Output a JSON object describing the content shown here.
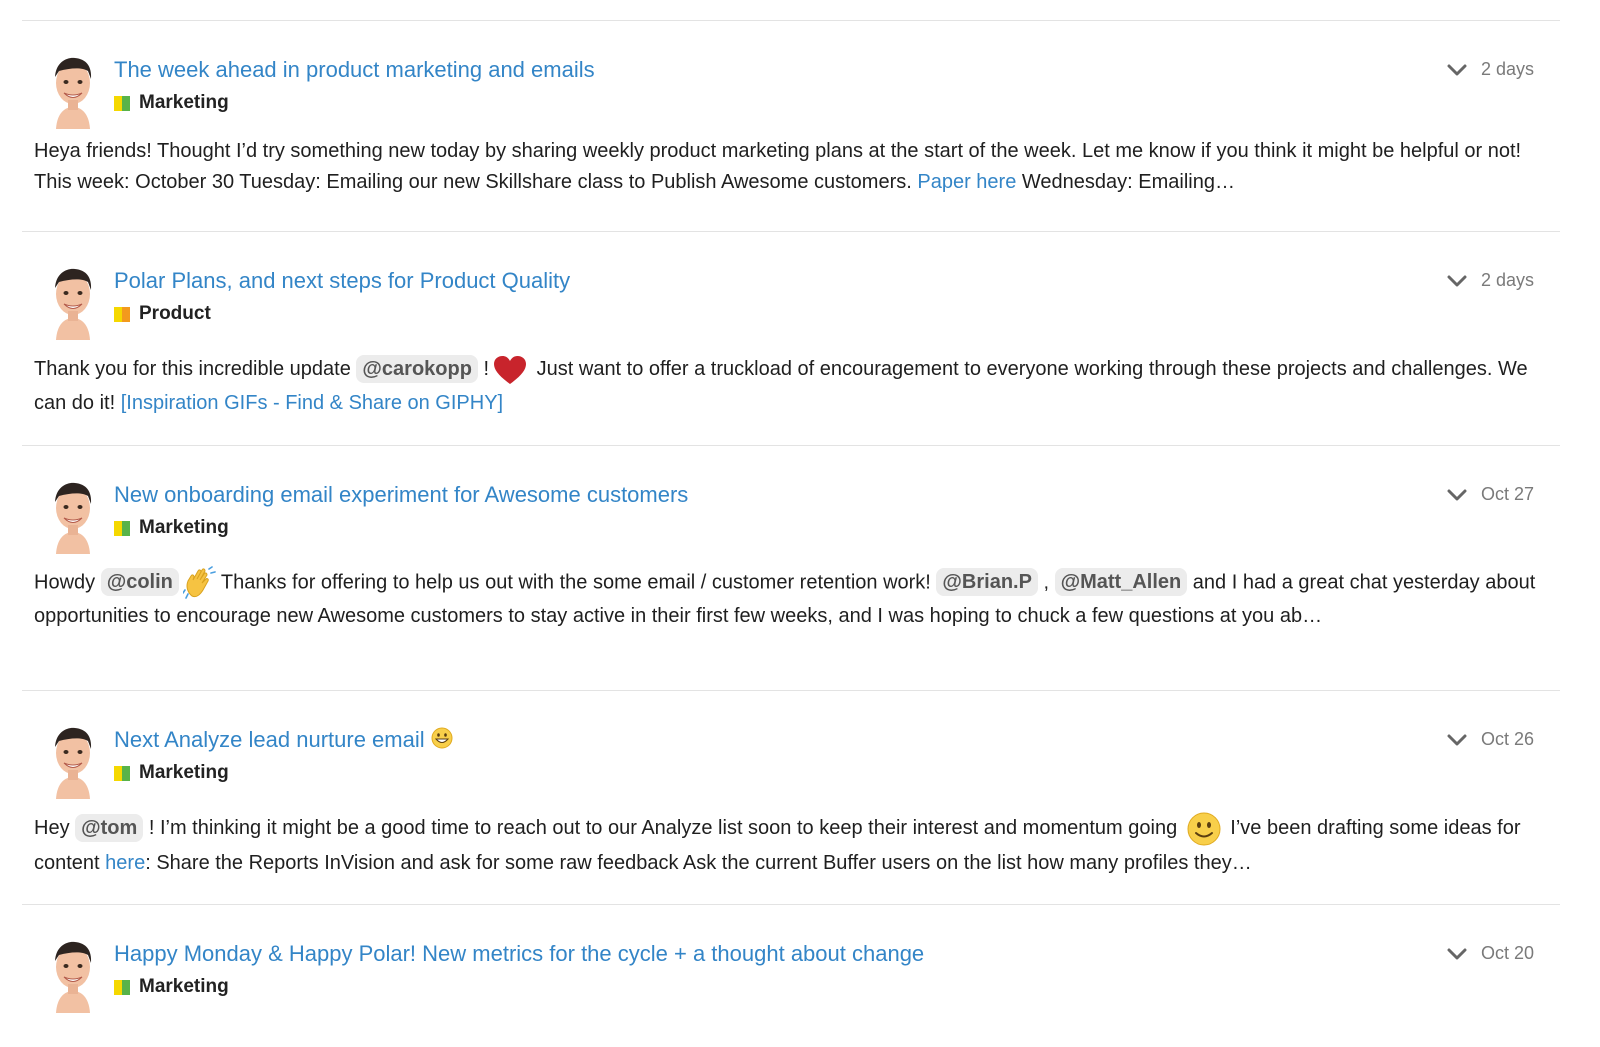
{
  "colors": {
    "link": "#3385c7",
    "category_marketing": [
      "#f5d800",
      "#58b349"
    ],
    "category_product": [
      "#f5d800",
      "#f39a1d"
    ],
    "meta_text": "#7a7a7a",
    "mention_bg": "#ececec"
  },
  "posts": [
    {
      "title": "The week ahead in product marketing and emails",
      "category": "Marketing",
      "age": "2 days",
      "body": {
        "t1": "Heya friends! Thought I’d try something new today by sharing weekly product marketing plans at the start of the week. Let me know if you think it might be helpful or not! This week: October 30 Tuesday: Emailing our new Skillshare class to Publish Awesome customers. ",
        "link1": "Paper here",
        "t2": " Wednesday: Emailing…"
      }
    },
    {
      "title": "Polar Plans, and next steps for Product Quality",
      "category": "Product",
      "age": "2 days",
      "body": {
        "t1": "Thank you for this incredible update ",
        "mention1": "@carokopp",
        "t2": " !",
        "emoji1": "red-heart",
        "t3": " Just want to offer a truckload of encouragement to everyone working through these projects and challenges. We can do it! ",
        "link1": "[Inspiration GIFs - Find & Share on GIPHY]"
      }
    },
    {
      "title": "New onboarding email experiment for Awesome customers",
      "category": "Marketing",
      "age": "Oct 27",
      "body": {
        "t1": "Howdy ",
        "mention1": "@colin",
        "emoji1": "waving-hand",
        "t2": "Thanks for offering to help us out with the some email / customer retention work! ",
        "mention2": "@Brian.P",
        "t3": " , ",
        "mention3": "@Matt_Allen",
        "t4": " and I had a great chat yesterday about opportunities to encourage new Awesome customers to stay active in their first few weeks, and I was hoping to chuck a few questions at you ab…"
      }
    },
    {
      "title": "Next Analyze lead nurture email",
      "title_emoji": "grinning-face",
      "category": "Marketing",
      "age": "Oct 26",
      "body": {
        "t1": "Hey ",
        "mention1": "@tom",
        "t2": " ! I’m thinking it might be a good time to reach out to our Analyze list soon to keep their interest and momentum going ",
        "emoji1": "slightly-smiling-face",
        "t3": " I’ve been drafting some ideas for content ",
        "link1": "here",
        "t4": ": Share the Reports InVision and ask for some raw feedback Ask the current Buffer users on the list how many profiles they…"
      }
    },
    {
      "title": "Happy Monday & Happy Polar! New metrics for the cycle + a thought about change",
      "category": "Marketing",
      "age": "Oct 20"
    }
  ]
}
